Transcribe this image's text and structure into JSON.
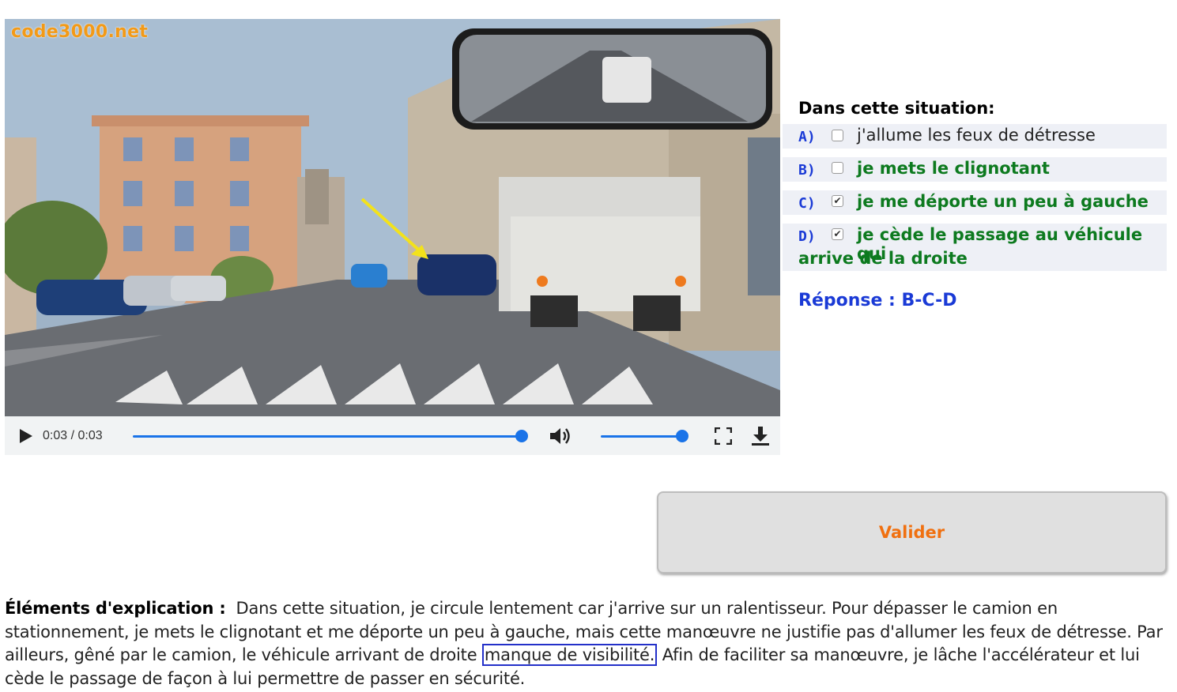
{
  "brand": "code3000.net",
  "video": {
    "time": "0:03 / 0:03",
    "progress": 1.0,
    "volume": 1.0,
    "icons": [
      "play-icon",
      "volume-icon",
      "fullscreen-icon",
      "download-icon"
    ]
  },
  "question": {
    "title": "Dans cette situation:",
    "answers": [
      {
        "letter": "A)",
        "text": "j'allume les feux de détresse",
        "checked": false,
        "correct": false
      },
      {
        "letter": "B)",
        "text": "je mets le clignotant",
        "checked": false,
        "correct": true
      },
      {
        "letter": "C)",
        "text": "je me déporte un peu à gauche",
        "checked": true,
        "correct": true
      },
      {
        "letter": "D)",
        "text": "je cède le passage au véhicule qui",
        "text_cont": "arrive de la droite",
        "checked": true,
        "correct": true
      }
    ],
    "answer_line": "Réponse : B-C-D"
  },
  "validate_label": "Valider",
  "explanation": {
    "label": "Éléments d'explication :",
    "part1": "Dans cette situation, je circule lentement car j'arrive sur un ralentisseur. Pour dépasser le camion en stationnement, je mets le clignotant et me déporte un peu à gauche, mais cette manœuvre ne justifie pas d'allumer les feux de détresse. Par ailleurs, gêné par le camion, le véhicule arrivant de droite",
    "highlight": "manque de visibilité.",
    "part2": "Afin de faciliter sa manœuvre, je lâche l'accélérateur et lui cède le passage de façon à lui permettre de passer en sécurité."
  },
  "colors": {
    "brand": "#f39a17",
    "letter": "#1a3ad6",
    "correct": "#0d7a1f",
    "accent": "#1a73e8",
    "validate_text": "#f07010",
    "highlight_border": "#2330c9"
  }
}
